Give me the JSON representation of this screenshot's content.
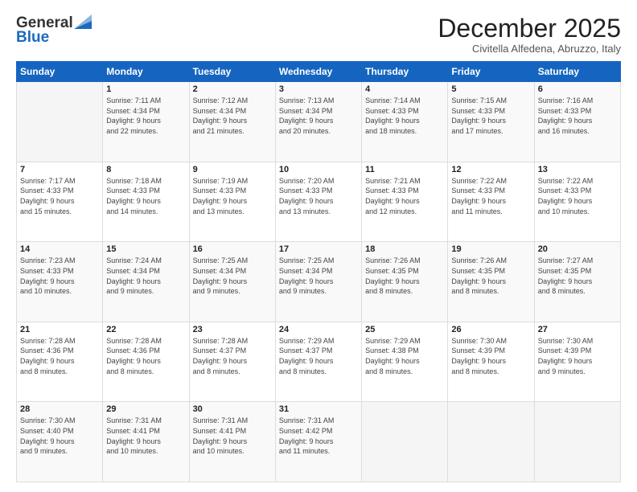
{
  "logo": {
    "general": "General",
    "blue": "Blue"
  },
  "header": {
    "month": "December 2025",
    "location": "Civitella Alfedena, Abruzzo, Italy"
  },
  "weekdays": [
    "Sunday",
    "Monday",
    "Tuesday",
    "Wednesday",
    "Thursday",
    "Friday",
    "Saturday"
  ],
  "weeks": [
    [
      {
        "day": "",
        "info": ""
      },
      {
        "day": "1",
        "info": "Sunrise: 7:11 AM\nSunset: 4:34 PM\nDaylight: 9 hours\nand 22 minutes."
      },
      {
        "day": "2",
        "info": "Sunrise: 7:12 AM\nSunset: 4:34 PM\nDaylight: 9 hours\nand 21 minutes."
      },
      {
        "day": "3",
        "info": "Sunrise: 7:13 AM\nSunset: 4:34 PM\nDaylight: 9 hours\nand 20 minutes."
      },
      {
        "day": "4",
        "info": "Sunrise: 7:14 AM\nSunset: 4:33 PM\nDaylight: 9 hours\nand 18 minutes."
      },
      {
        "day": "5",
        "info": "Sunrise: 7:15 AM\nSunset: 4:33 PM\nDaylight: 9 hours\nand 17 minutes."
      },
      {
        "day": "6",
        "info": "Sunrise: 7:16 AM\nSunset: 4:33 PM\nDaylight: 9 hours\nand 16 minutes."
      }
    ],
    [
      {
        "day": "7",
        "info": "Sunrise: 7:17 AM\nSunset: 4:33 PM\nDaylight: 9 hours\nand 15 minutes."
      },
      {
        "day": "8",
        "info": "Sunrise: 7:18 AM\nSunset: 4:33 PM\nDaylight: 9 hours\nand 14 minutes."
      },
      {
        "day": "9",
        "info": "Sunrise: 7:19 AM\nSunset: 4:33 PM\nDaylight: 9 hours\nand 13 minutes."
      },
      {
        "day": "10",
        "info": "Sunrise: 7:20 AM\nSunset: 4:33 PM\nDaylight: 9 hours\nand 13 minutes."
      },
      {
        "day": "11",
        "info": "Sunrise: 7:21 AM\nSunset: 4:33 PM\nDaylight: 9 hours\nand 12 minutes."
      },
      {
        "day": "12",
        "info": "Sunrise: 7:22 AM\nSunset: 4:33 PM\nDaylight: 9 hours\nand 11 minutes."
      },
      {
        "day": "13",
        "info": "Sunrise: 7:22 AM\nSunset: 4:33 PM\nDaylight: 9 hours\nand 10 minutes."
      }
    ],
    [
      {
        "day": "14",
        "info": "Sunrise: 7:23 AM\nSunset: 4:33 PM\nDaylight: 9 hours\nand 10 minutes."
      },
      {
        "day": "15",
        "info": "Sunrise: 7:24 AM\nSunset: 4:34 PM\nDaylight: 9 hours\nand 9 minutes."
      },
      {
        "day": "16",
        "info": "Sunrise: 7:25 AM\nSunset: 4:34 PM\nDaylight: 9 hours\nand 9 minutes."
      },
      {
        "day": "17",
        "info": "Sunrise: 7:25 AM\nSunset: 4:34 PM\nDaylight: 9 hours\nand 9 minutes."
      },
      {
        "day": "18",
        "info": "Sunrise: 7:26 AM\nSunset: 4:35 PM\nDaylight: 9 hours\nand 8 minutes."
      },
      {
        "day": "19",
        "info": "Sunrise: 7:26 AM\nSunset: 4:35 PM\nDaylight: 9 hours\nand 8 minutes."
      },
      {
        "day": "20",
        "info": "Sunrise: 7:27 AM\nSunset: 4:35 PM\nDaylight: 9 hours\nand 8 minutes."
      }
    ],
    [
      {
        "day": "21",
        "info": "Sunrise: 7:28 AM\nSunset: 4:36 PM\nDaylight: 9 hours\nand 8 minutes."
      },
      {
        "day": "22",
        "info": "Sunrise: 7:28 AM\nSunset: 4:36 PM\nDaylight: 9 hours\nand 8 minutes."
      },
      {
        "day": "23",
        "info": "Sunrise: 7:28 AM\nSunset: 4:37 PM\nDaylight: 9 hours\nand 8 minutes."
      },
      {
        "day": "24",
        "info": "Sunrise: 7:29 AM\nSunset: 4:37 PM\nDaylight: 9 hours\nand 8 minutes."
      },
      {
        "day": "25",
        "info": "Sunrise: 7:29 AM\nSunset: 4:38 PM\nDaylight: 9 hours\nand 8 minutes."
      },
      {
        "day": "26",
        "info": "Sunrise: 7:30 AM\nSunset: 4:39 PM\nDaylight: 9 hours\nand 8 minutes."
      },
      {
        "day": "27",
        "info": "Sunrise: 7:30 AM\nSunset: 4:39 PM\nDaylight: 9 hours\nand 9 minutes."
      }
    ],
    [
      {
        "day": "28",
        "info": "Sunrise: 7:30 AM\nSunset: 4:40 PM\nDaylight: 9 hours\nand 9 minutes."
      },
      {
        "day": "29",
        "info": "Sunrise: 7:31 AM\nSunset: 4:41 PM\nDaylight: 9 hours\nand 10 minutes."
      },
      {
        "day": "30",
        "info": "Sunrise: 7:31 AM\nSunset: 4:41 PM\nDaylight: 9 hours\nand 10 minutes."
      },
      {
        "day": "31",
        "info": "Sunrise: 7:31 AM\nSunset: 4:42 PM\nDaylight: 9 hours\nand 11 minutes."
      },
      {
        "day": "",
        "info": ""
      },
      {
        "day": "",
        "info": ""
      },
      {
        "day": "",
        "info": ""
      }
    ]
  ]
}
